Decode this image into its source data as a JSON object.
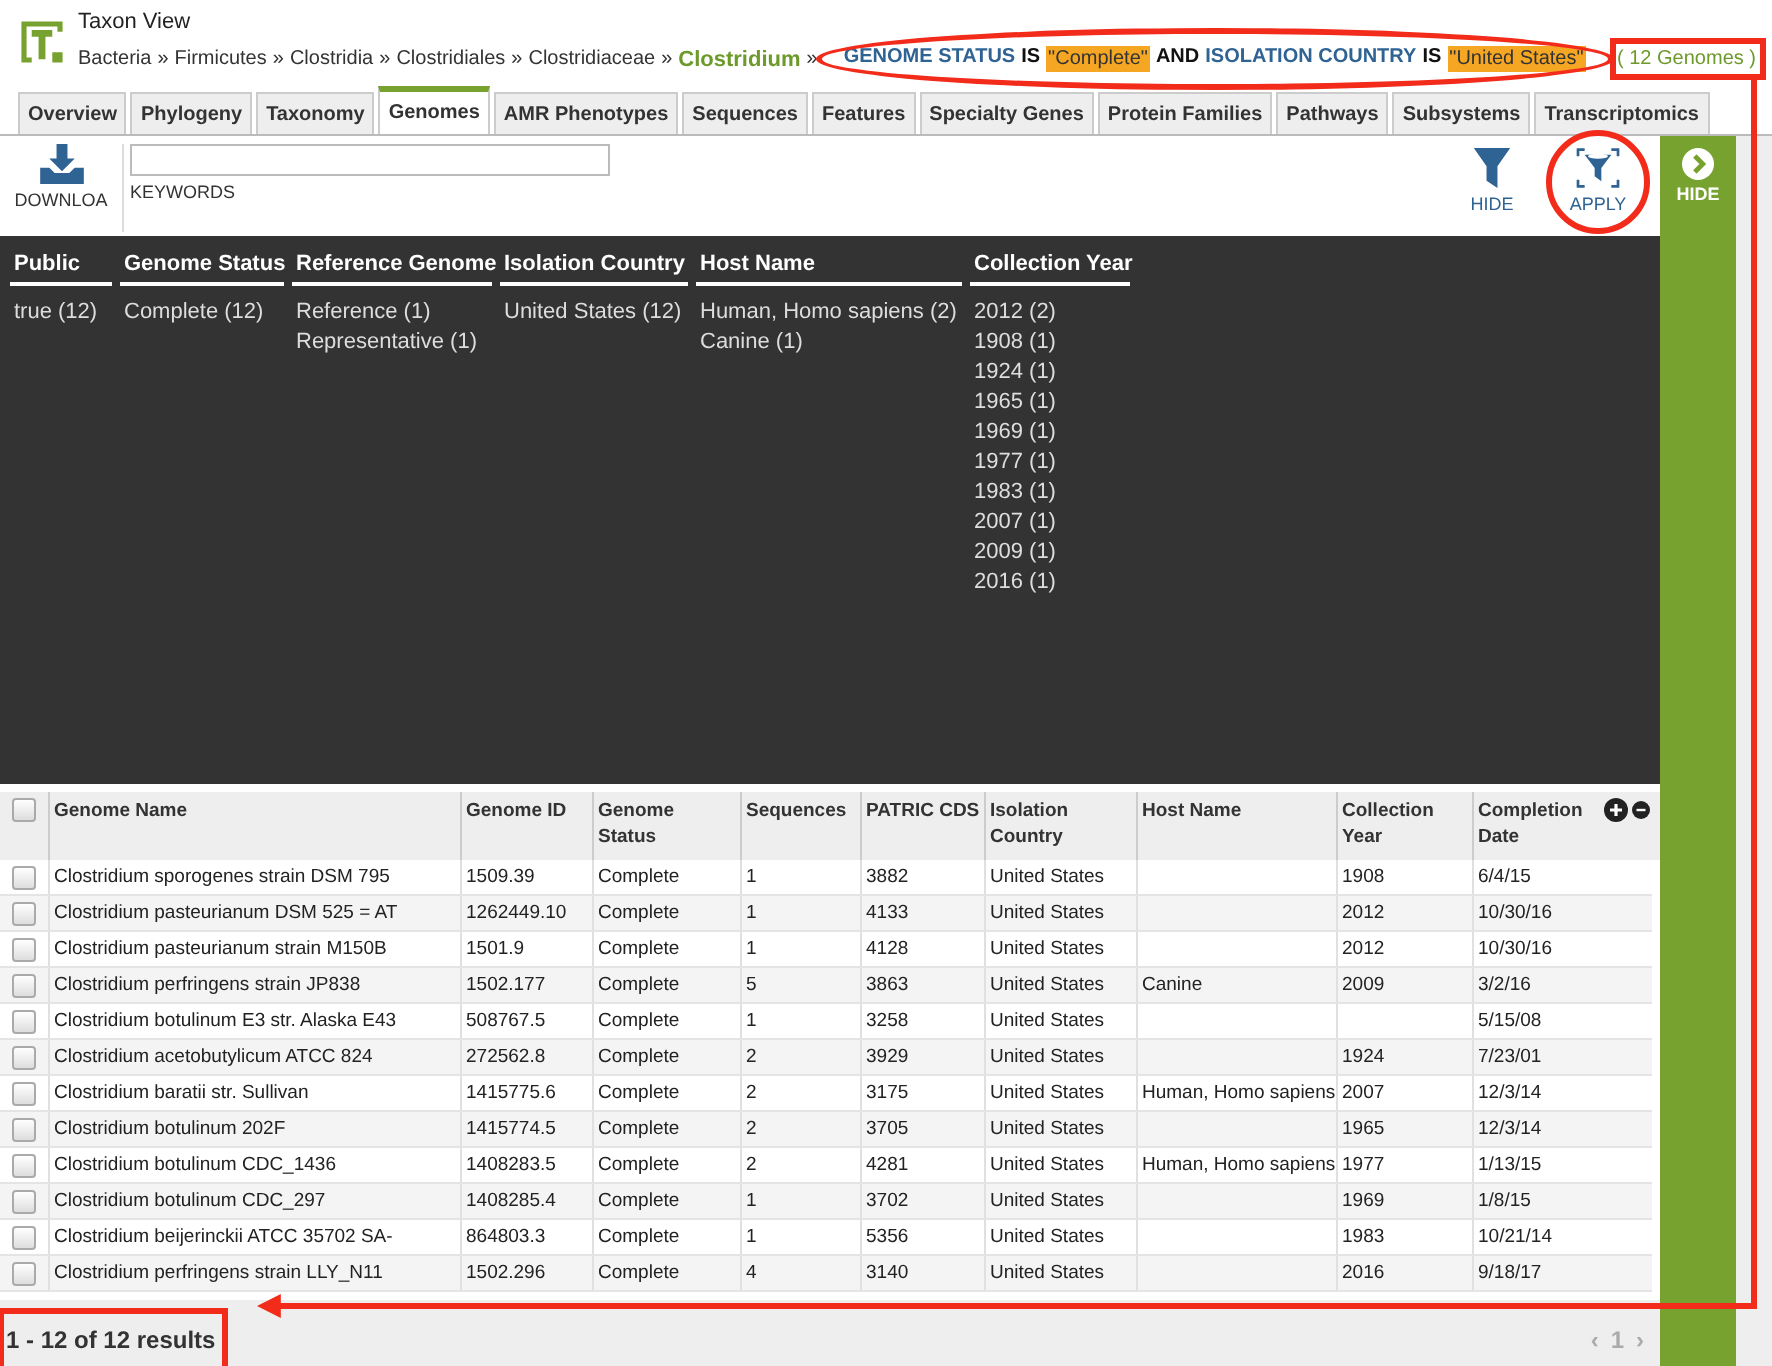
{
  "header": {
    "title": "Taxon View",
    "breadcrumb": [
      "Bacteria",
      "Firmicutes",
      "Clostridia",
      "Clostridiales",
      "Clostridiaceae"
    ],
    "separator": "»",
    "current": "Clostridium",
    "filter": [
      {
        "kind": "field",
        "text": "GENOME STATUS"
      },
      {
        "kind": "word",
        "text": "IS"
      },
      {
        "kind": "value",
        "text": "\"Complete\""
      },
      {
        "kind": "word",
        "text": "AND"
      },
      {
        "kind": "field",
        "text": "ISOLATION COUNTRY"
      },
      {
        "kind": "word",
        "text": "IS"
      },
      {
        "kind": "value",
        "text": "\"United States\""
      }
    ],
    "count": "( 12 Genomes )"
  },
  "tabs": [
    {
      "label": "Overview",
      "selected": false
    },
    {
      "label": "Phylogeny",
      "selected": false
    },
    {
      "label": "Taxonomy",
      "selected": false
    },
    {
      "label": "Genomes",
      "selected": true
    },
    {
      "label": "AMR Phenotypes",
      "selected": false
    },
    {
      "label": "Sequences",
      "selected": false
    },
    {
      "label": "Features",
      "selected": false
    },
    {
      "label": "Specialty Genes",
      "selected": false
    },
    {
      "label": "Protein Families",
      "selected": false
    },
    {
      "label": "Pathways",
      "selected": false
    },
    {
      "label": "Subsystems",
      "selected": false
    },
    {
      "label": "Transcriptomics",
      "selected": false
    }
  ],
  "toolbar": {
    "download": "DOWNLOA",
    "keywords_label": "KEYWORDS",
    "hide": "HIDE",
    "apply": "APPLY"
  },
  "side_panel": {
    "hide": "HIDE"
  },
  "facets": [
    {
      "title": "Public",
      "values": [
        "true (12)"
      ]
    },
    {
      "title": "Genome Status",
      "values": [
        "Complete (12)"
      ]
    },
    {
      "title": "Reference Genome",
      "values": [
        "Reference (1)",
        "Representative (1)"
      ]
    },
    {
      "title": "Isolation Country",
      "values": [
        "United States (12)"
      ]
    },
    {
      "title": "Host Name",
      "values": [
        "Human, Homo sapiens (2)",
        "Canine (1)"
      ]
    },
    {
      "title": "Collection Year",
      "values": [
        "2012 (2)",
        "1908 (1)",
        "1924 (1)",
        "1965 (1)",
        "1969 (1)",
        "1977 (1)",
        "1983 (1)",
        "2007 (1)",
        "2009 (1)",
        "2016 (1)"
      ]
    }
  ],
  "table": {
    "all_checked": false,
    "columns": [
      "Genome Name",
      "Genome ID",
      "Genome Status",
      "Sequences",
      "PATRIC CDS",
      "Isolation Country",
      "Host Name",
      "Collection Year",
      "Completion Date"
    ],
    "rows": [
      {
        "checked": false,
        "cells": [
          "Clostridium sporogenes strain DSM 795",
          "1509.39",
          "Complete",
          "1",
          "3882",
          "United States",
          "",
          "1908",
          "6/4/15"
        ]
      },
      {
        "checked": false,
        "cells": [
          "Clostridium pasteurianum DSM 525 = AT",
          "1262449.10",
          "Complete",
          "1",
          "4133",
          "United States",
          "",
          "2012",
          "10/30/16"
        ]
      },
      {
        "checked": false,
        "cells": [
          "Clostridium pasteurianum strain M150B",
          "1501.9",
          "Complete",
          "1",
          "4128",
          "United States",
          "",
          "2012",
          "10/30/16"
        ]
      },
      {
        "checked": false,
        "cells": [
          "Clostridium perfringens strain JP838",
          "1502.177",
          "Complete",
          "5",
          "3863",
          "United States",
          "Canine",
          "2009",
          "3/2/16"
        ]
      },
      {
        "checked": false,
        "cells": [
          "Clostridium botulinum E3 str. Alaska E43",
          "508767.5",
          "Complete",
          "1",
          "3258",
          "United States",
          "",
          "",
          "5/15/08"
        ]
      },
      {
        "checked": false,
        "cells": [
          "Clostridium acetobutylicum ATCC 824",
          "272562.8",
          "Complete",
          "2",
          "3929",
          "United States",
          "",
          "1924",
          "7/23/01"
        ]
      },
      {
        "checked": false,
        "cells": [
          "Clostridium baratii str. Sullivan",
          "1415775.6",
          "Complete",
          "2",
          "3175",
          "United States",
          "Human, Homo sapiens",
          "2007",
          "12/3/14"
        ]
      },
      {
        "checked": false,
        "cells": [
          "Clostridium botulinum 202F",
          "1415774.5",
          "Complete",
          "2",
          "3705",
          "United States",
          "",
          "1965",
          "12/3/14"
        ]
      },
      {
        "checked": false,
        "cells": [
          "Clostridium botulinum CDC_1436",
          "1408283.5",
          "Complete",
          "2",
          "4281",
          "United States",
          "Human, Homo sapiens",
          "1977",
          "1/13/15"
        ]
      },
      {
        "checked": false,
        "cells": [
          "Clostridium botulinum CDC_297",
          "1408285.4",
          "Complete",
          "1",
          "3702",
          "United States",
          "",
          "1969",
          "1/8/15"
        ]
      },
      {
        "checked": false,
        "cells": [
          "Clostridium beijerinckii ATCC 35702 SA-",
          "864803.3",
          "Complete",
          "1",
          "5356",
          "United States",
          "",
          "1983",
          "10/21/14"
        ]
      },
      {
        "checked": false,
        "cells": [
          "Clostridium perfringens strain LLY_N11",
          "1502.296",
          "Complete",
          "4",
          "3140",
          "United States",
          "",
          "2016",
          "9/18/17"
        ]
      }
    ]
  },
  "footer": {
    "results": "1 - 12 of 12 results",
    "prev": "‹",
    "page": "1",
    "next": "›"
  }
}
